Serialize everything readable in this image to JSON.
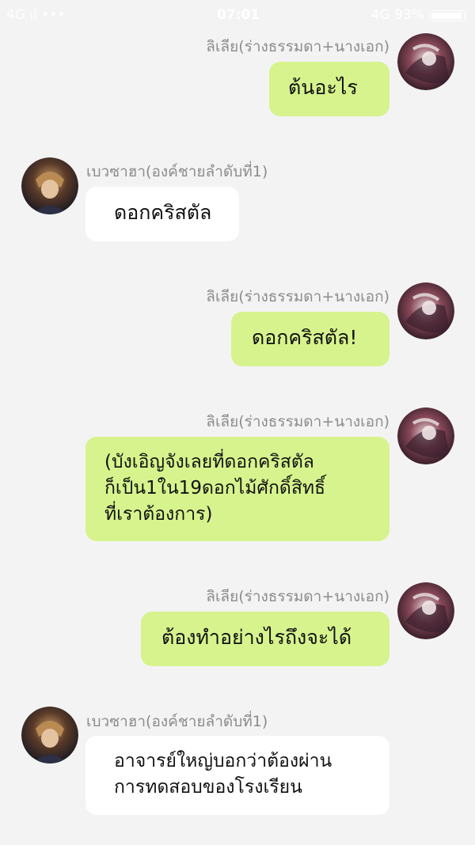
{
  "status_bar": {
    "left": "4G.ıl  •••",
    "time": "07:01",
    "right": "4G 93%"
  },
  "users": {
    "heroine": {
      "name": "ลิเลีย(ร่างธรรมดา+นางเอก)",
      "avatar": "heroine-avatar"
    },
    "prince": {
      "name": "เบวซาฮา(องค์ชายลำดับที่1)",
      "avatar": "prince-avatar"
    }
  },
  "messages": [
    {
      "sender": "ลิเลีย(ร่างธรรมดา+นางเอก)",
      "text": "ต้นอะไร"
    },
    {
      "sender": "เบวซาฮา(องค์ชายลำดับที่1)",
      "text": "ดอกคริสตัล"
    },
    {
      "sender": "ลิเลีย(ร่างธรรมดา+นางเอก)",
      "text": "ดอกคริสตัล!"
    },
    {
      "sender": "ลิเลีย(ร่างธรรมดา+นางเอก)",
      "text": "(บังเอิญจังเลยที่ดอกคริสตัล\nก็เป็น1ใน19ดอกไม้ศักดิ์สิทธิ์\nที่เราต้องการ)"
    },
    {
      "sender": "ลิเลีย(ร่างธรรมดา+นางเอก)",
      "text": "ต้องทำอย่างไรถึงจะได้"
    },
    {
      "sender": "เบวซาฮา(องค์ชายลำดับที่1)",
      "text": "อาจารย์ใหญ่บอกว่าต้องผ่าน\nการทดสอบของโรงเรียน"
    }
  ],
  "colors": {
    "background": "#f3f3f3",
    "my_bubble": "#d6f38d",
    "their_bubble": "#ffffff",
    "name_text": "#8c8c8c"
  }
}
